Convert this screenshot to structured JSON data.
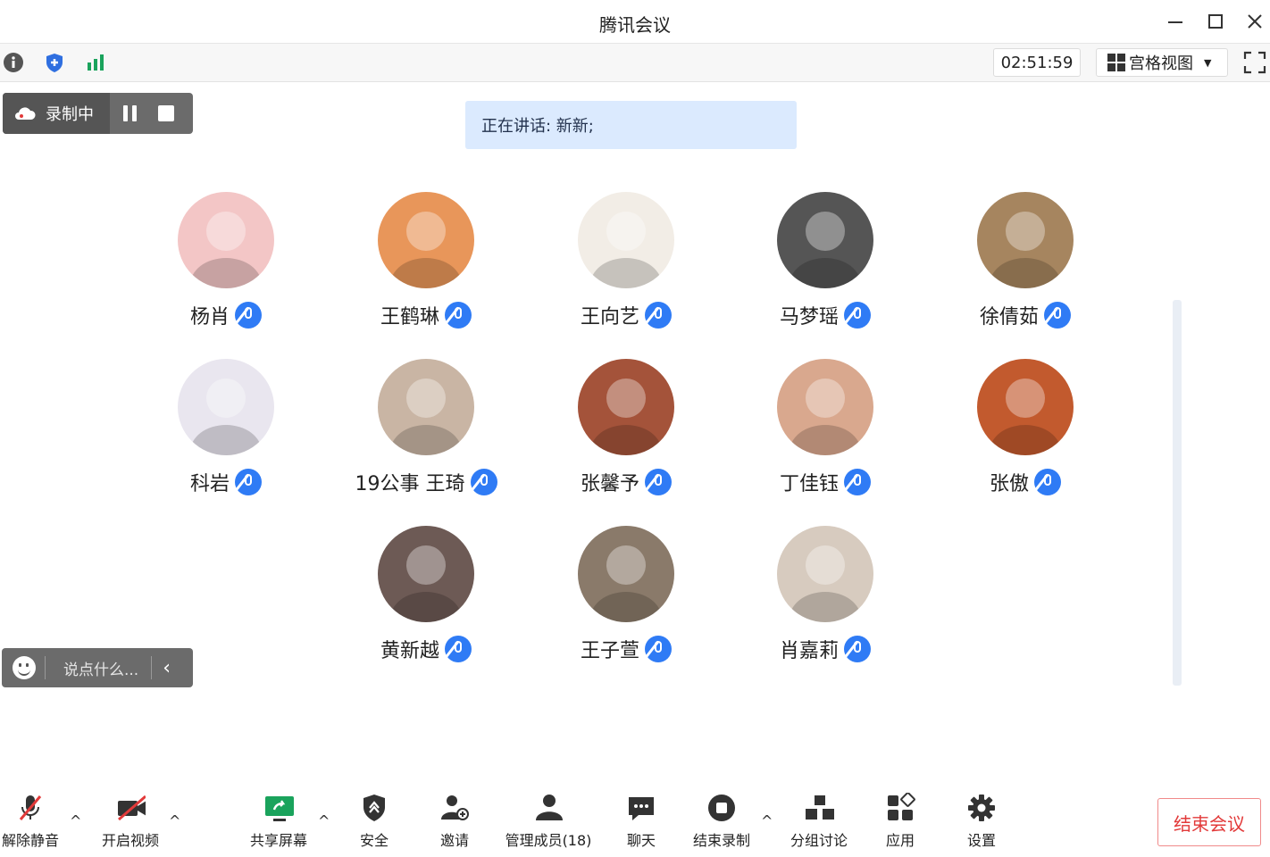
{
  "window": {
    "title": "腾讯会议"
  },
  "toolbar": {
    "timer": "02:51:59",
    "view_label": "宫格视图"
  },
  "recording": {
    "label": "录制中"
  },
  "speaking": {
    "text": "正在讲话: 新新;"
  },
  "members": [
    {
      "name": "杨肖",
      "avatar_color": "#f3c6c6"
    },
    {
      "name": "王鹤琳",
      "avatar_color": "#e8965a"
    },
    {
      "name": "王向艺",
      "avatar_color": "#f2ede6"
    },
    {
      "name": "马梦瑶",
      "avatar_color": "#555555"
    },
    {
      "name": "徐倩茹",
      "avatar_color": "#a6855f"
    },
    {
      "name": "科岩",
      "avatar_color": "#e9e6ef"
    },
    {
      "name": "19公事 王琦",
      "avatar_color": "#c9b5a4"
    },
    {
      "name": "张馨予",
      "avatar_color": "#a4533a"
    },
    {
      "name": "丁佳钰",
      "avatar_color": "#d9a88e"
    },
    {
      "name": "张傲",
      "avatar_color": "#c25a2e"
    },
    {
      "name": "黄新越",
      "avatar_color": "#6d5a55"
    },
    {
      "name": "王子萱",
      "avatar_color": "#8a7a6a"
    },
    {
      "name": "肖嘉莉",
      "avatar_color": "#d7cbbf"
    }
  ],
  "chat": {
    "placeholder": "说点什么..."
  },
  "bottom": {
    "unmute": "解除静音",
    "video": "开启视频",
    "share": "共享屏幕",
    "security": "安全",
    "invite": "邀请",
    "members": "管理成员(18)",
    "chat": "聊天",
    "stop_record": "结束录制",
    "breakout": "分组讨论",
    "apps": "应用",
    "settings": "设置",
    "end": "结束会议"
  },
  "colors": {
    "accent": "#2f7bf5",
    "danger": "#e23a3a",
    "share_green": "#1aa35c"
  }
}
